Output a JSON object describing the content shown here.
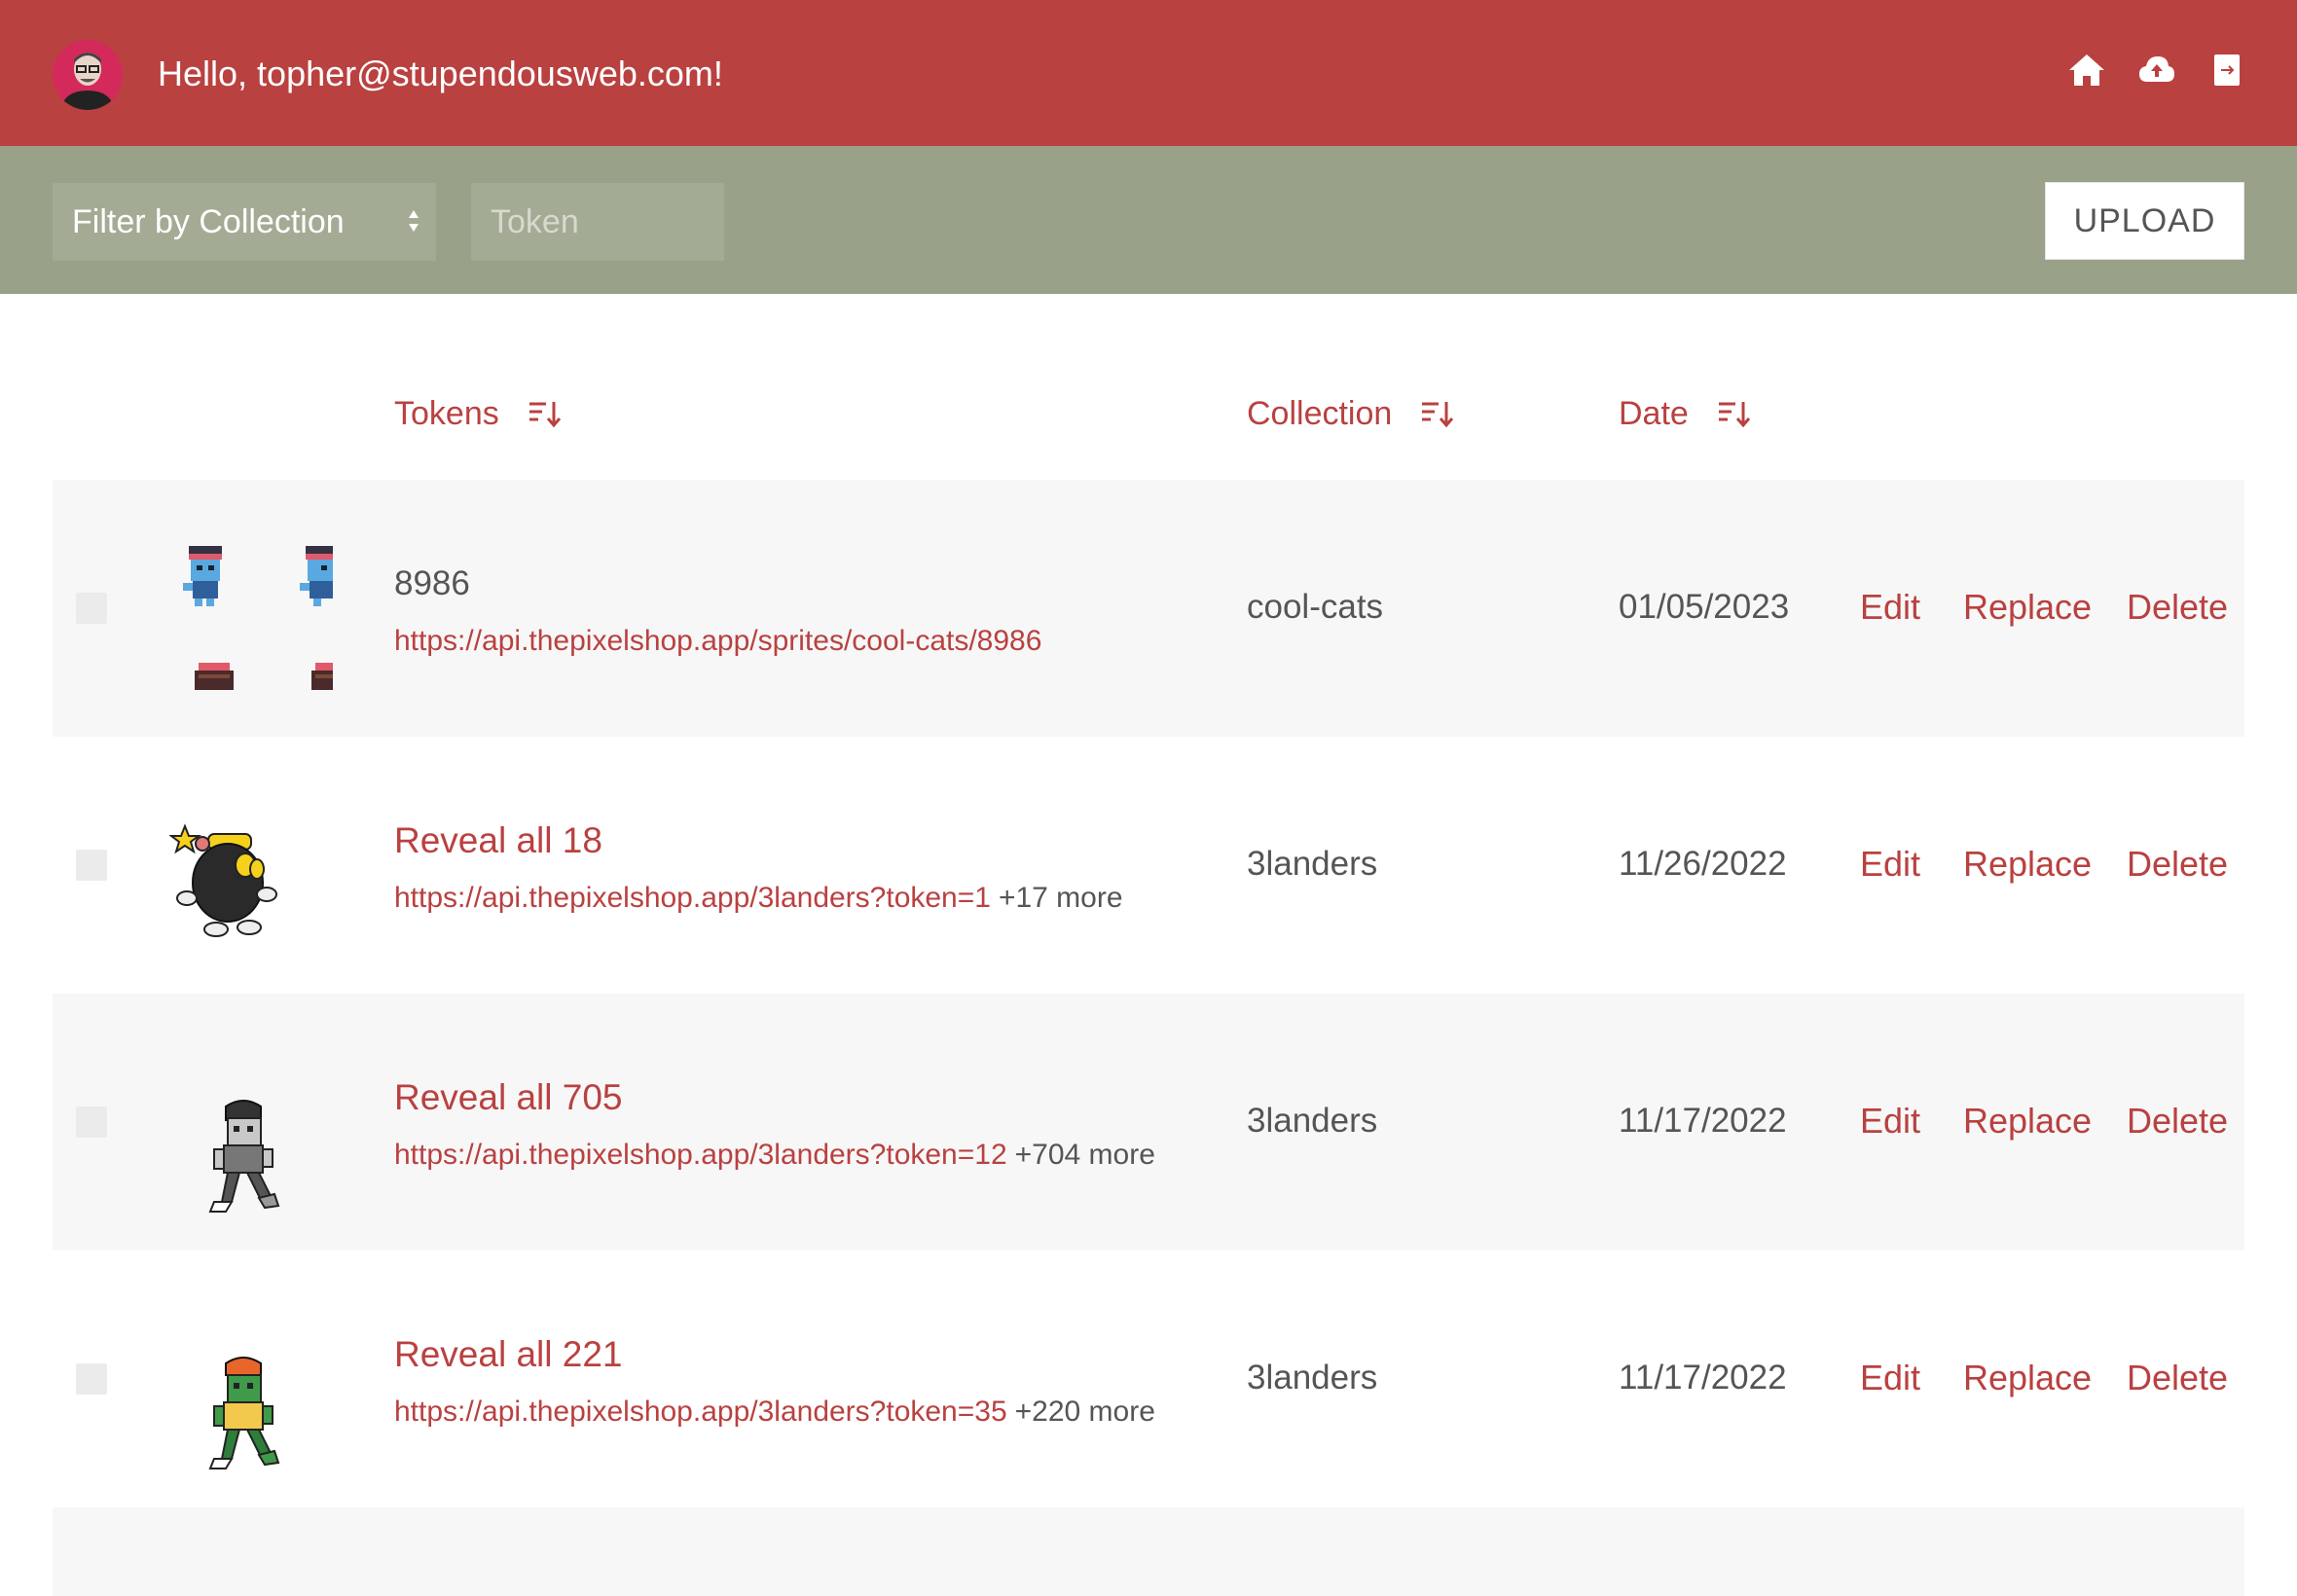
{
  "header": {
    "greeting": "Hello, topher@stupendousweb.com!",
    "icons": [
      "home-icon",
      "cloud-upload-icon",
      "logout-icon"
    ]
  },
  "filters": {
    "collection_select": "Filter by Collection",
    "token_placeholder": "Token",
    "upload_label": "UPLOAD"
  },
  "table": {
    "columns": [
      "Tokens",
      "Collection",
      "Date"
    ],
    "actions": [
      "Edit",
      "Replace",
      "Delete"
    ],
    "rows": [
      {
        "title": "8986",
        "url": "https://api.thepixelshop.app/sprites/cool-cats/8986",
        "more": "",
        "collection": "cool-cats",
        "date": "01/05/2023"
      },
      {
        "title": "Reveal all 18",
        "url": "https://api.thepixelshop.app/3landers?token=1",
        "more": "+17 more",
        "collection": "3landers",
        "date": "11/26/2022"
      },
      {
        "title": "Reveal all 705",
        "url": "https://api.thepixelshop.app/3landers?token=12",
        "more": "+704 more",
        "collection": "3landers",
        "date": "11/17/2022"
      },
      {
        "title": "Reveal all 221",
        "url": "https://api.thepixelshop.app/3landers?token=35",
        "more": "+220 more",
        "collection": "3landers",
        "date": "11/17/2022"
      }
    ]
  },
  "colors": {
    "brand_red": "#b94140",
    "filter_bar": "#99a189",
    "row_shade": "#f7f7f7",
    "text_gray": "#555555"
  }
}
